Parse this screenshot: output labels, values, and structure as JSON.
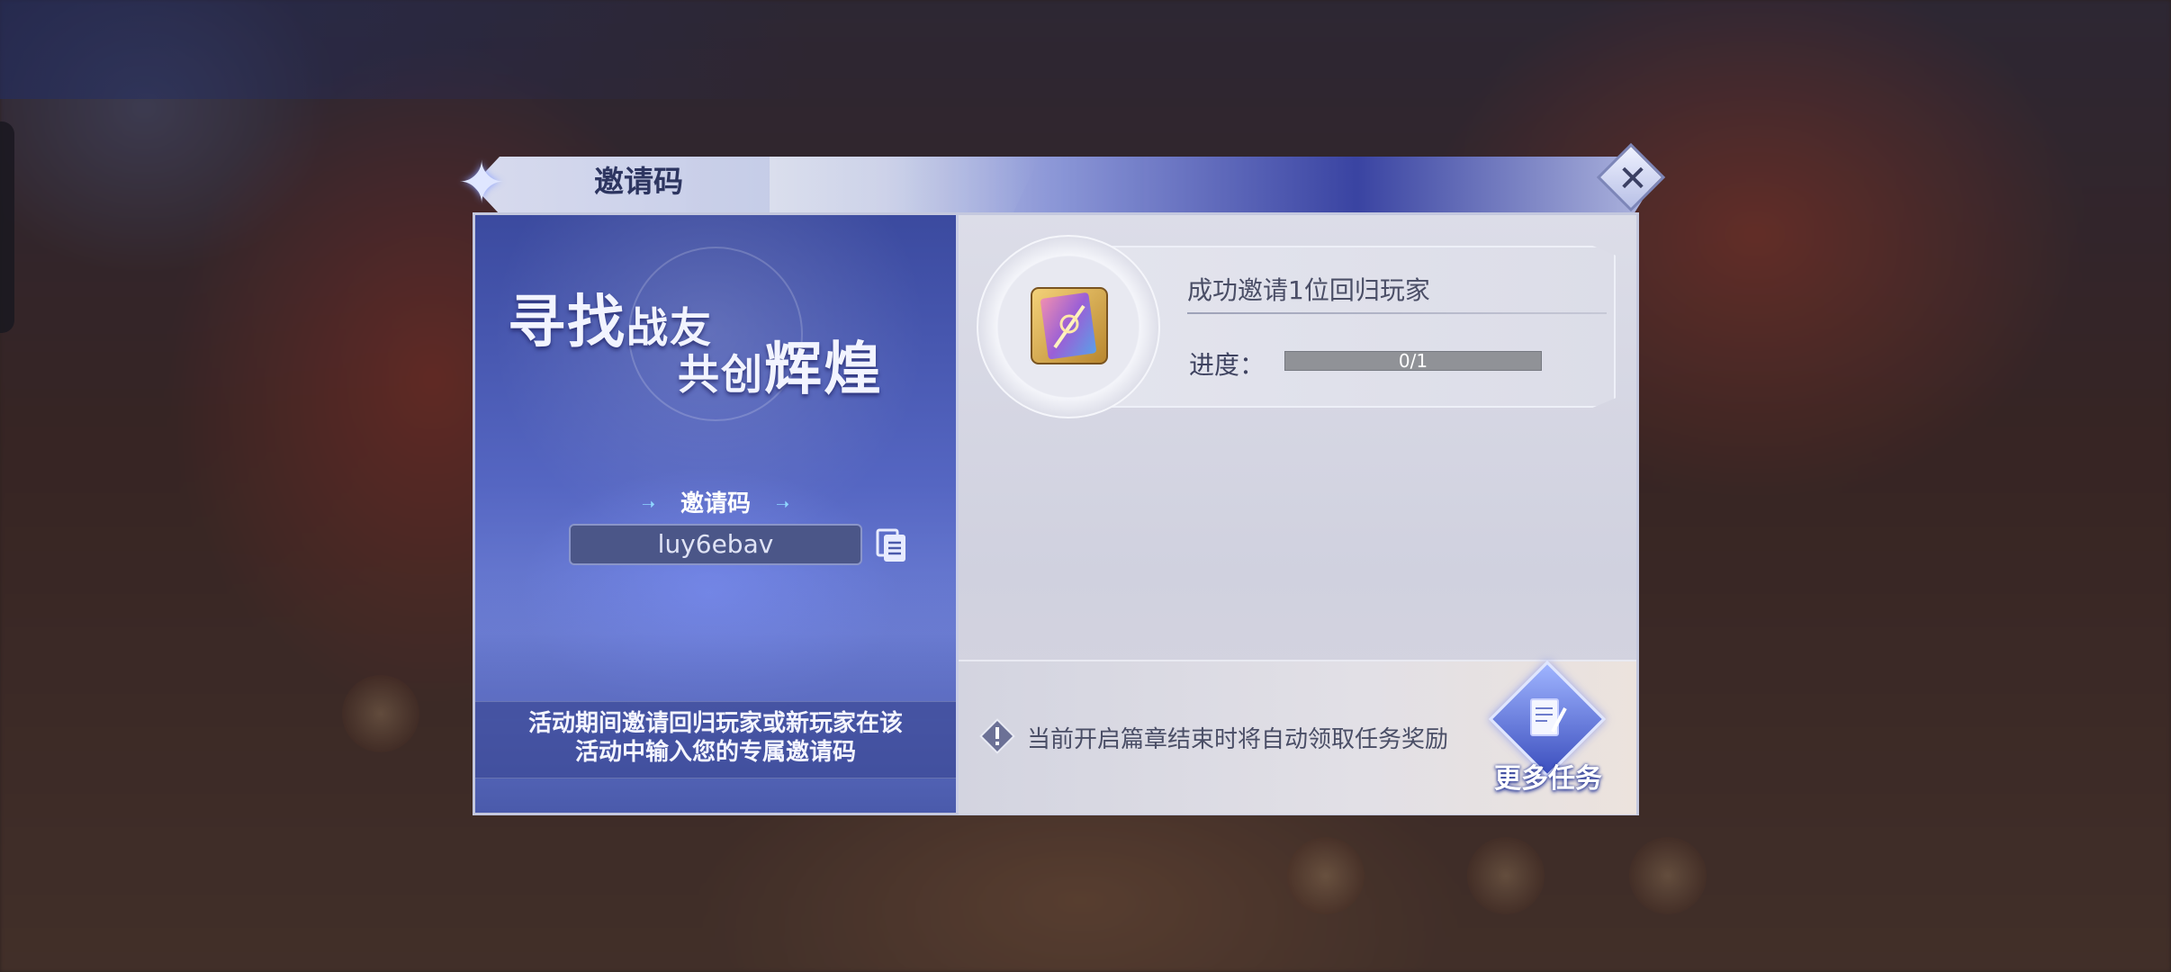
{
  "dialog": {
    "title": "邀请码",
    "close_label": "✕"
  },
  "left_panel": {
    "slogan_line1_big": "寻找",
    "slogan_line1_small": "战友",
    "slogan_line2_small": "共创",
    "slogan_line2_big": "辉煌",
    "code_label": "邀请码",
    "invite_code": "luy6ebav",
    "description_line1": "活动期间邀请回归玩家或新玩家在该",
    "description_line2": "活动中输入您的专属邀请码"
  },
  "task": {
    "title": "成功邀请1位回归玩家",
    "progress_label": "进度：",
    "progress_text": "0/1",
    "progress_current": 0,
    "progress_total": 1
  },
  "footer": {
    "notice": "当前开启篇章结束时将自动领取任务奖励",
    "more_tasks_label": "更多任务"
  },
  "icons": {
    "copy": "copy-icon",
    "info": "info-icon",
    "close": "close-icon",
    "reward": "reward-book-icon",
    "more_tasks": "document-pen-icon"
  },
  "colors": {
    "progress_bar": "#909297",
    "left_panel_blue": "#4a5aab",
    "title_text": "#2d3560"
  }
}
